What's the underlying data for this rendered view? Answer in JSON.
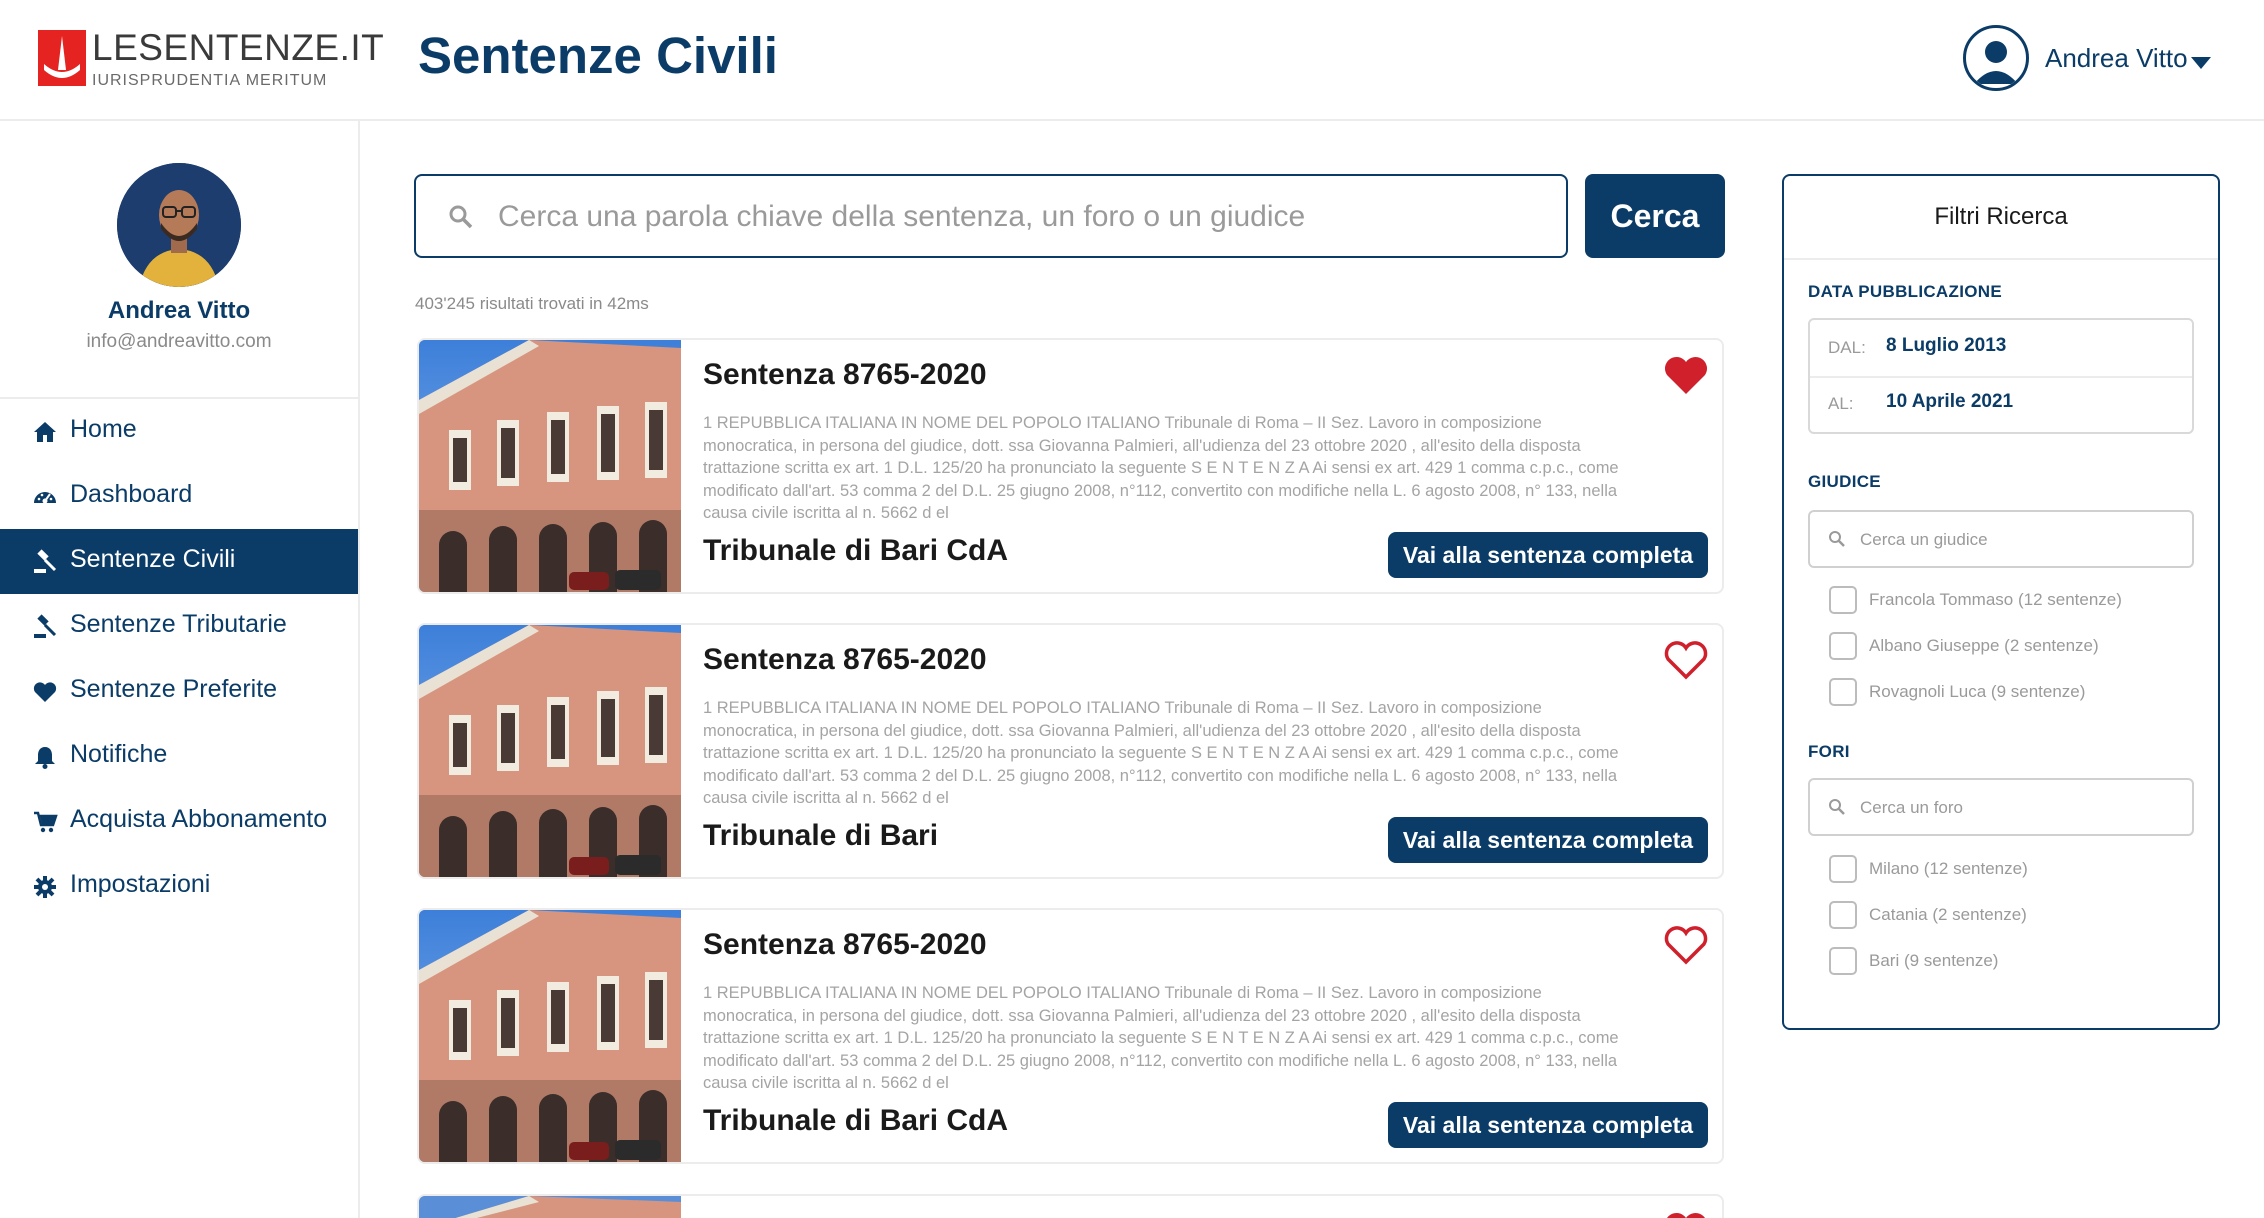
{
  "brand": {
    "name": "LESENTENZE.IT",
    "tagline": "IURISPRUDENTIA MERITUM",
    "color": "#e52421"
  },
  "colors": {
    "primary": "#0b3c67",
    "favorite": "#d0202c"
  },
  "header": {
    "title": "Sentenze Civili",
    "user_name": "Andrea Vitto"
  },
  "profile": {
    "name": "Andrea Vitto",
    "email": "info@andreavitto.com"
  },
  "nav": {
    "items": [
      {
        "label": "Home",
        "icon": "home-icon",
        "active": false
      },
      {
        "label": "Dashboard",
        "icon": "dashboard-icon",
        "active": false
      },
      {
        "label": "Sentenze Civili",
        "icon": "gavel-icon",
        "active": true
      },
      {
        "label": "Sentenze Tributarie",
        "icon": "gavel-icon",
        "active": false
      },
      {
        "label": "Sentenze Preferite",
        "icon": "heart-icon",
        "active": false
      },
      {
        "label": "Notifiche",
        "icon": "bell-icon",
        "active": false
      },
      {
        "label": "Acquista Abbonamento",
        "icon": "cart-icon",
        "active": false
      },
      {
        "label": "Impostazioni",
        "icon": "gear-icon",
        "active": false
      }
    ]
  },
  "search": {
    "placeholder": "Cerca una parola chiave della sentenza, un foro o un giudice",
    "value": "",
    "button_label": "Cerca",
    "results_count": "403'245 risultati trovati in 42ms"
  },
  "results": [
    {
      "title": "Sentenza 8765-2020",
      "text": "1 REPUBBLICA ITALIANA IN NOME DEL POPOLO ITALIANO Tribunale di Roma – II Sez. Lavoro in composizione monocratica, in persona del giudice, dott. ssa Giovanna Palmieri, all'udienza del 23 ottobre 2020 , all'esito della disposta trattazione scritta ex art. 1 D.L. 125/20 ha pronunciato la seguente S E N T E N Z A Ai sensi ex art. 429 1 comma c.p.c., come modificato dall'art. 53 comma 2 del D.L. 25 giugno 2008, n°112, convertito con modifiche nella L. 6 agosto 2008, n° 133, nella causa civile iscritta al n. 5662 d el",
      "court": "Tribunale di Bari CdA",
      "button_label": "Vai alla sentenza completa",
      "favorite": true
    },
    {
      "title": "Sentenza 8765-2020",
      "text": "1 REPUBBLICA ITALIANA IN NOME DEL POPOLO ITALIANO Tribunale di Roma – II Sez. Lavoro in composizione monocratica, in persona del giudice, dott. ssa Giovanna Palmieri, all'udienza del 23 ottobre 2020 , all'esito della disposta trattazione scritta ex art. 1 D.L. 125/20 ha pronunciato la seguente S E N T E N Z A Ai sensi ex art. 429 1 comma c.p.c., come modificato dall'art. 53 comma 2 del D.L. 25 giugno 2008, n°112, convertito con modifiche nella L. 6 agosto 2008, n° 133, nella causa civile iscritta al n. 5662 d el",
      "court": "Tribunale di Bari",
      "button_label": "Vai alla sentenza completa",
      "favorite": false
    },
    {
      "title": "Sentenza 8765-2020",
      "text": "1 REPUBBLICA ITALIANA IN NOME DEL POPOLO ITALIANO Tribunale di Roma – II Sez. Lavoro in composizione monocratica, in persona del giudice, dott. ssa Giovanna Palmieri, all'udienza del 23 ottobre 2020 , all'esito della disposta trattazione scritta ex art. 1 D.L. 125/20 ha pronunciato la seguente S E N T E N Z A Ai sensi ex art. 429 1 comma c.p.c., come modificato dall'art. 53 comma 2 del D.L. 25 giugno 2008, n°112, convertito con modifiche nella L. 6 agosto 2008, n° 133, nella causa civile iscritta al n. 5662 d el",
      "court": "Tribunale di Bari CdA",
      "button_label": "Vai alla sentenza completa",
      "favorite": false
    },
    {
      "title": "",
      "text": "",
      "court": "",
      "button_label": "",
      "favorite": true
    }
  ],
  "filters": {
    "title": "Filtri Ricerca",
    "date_section": "DATA PUBBLICAZIONE",
    "from_label": "DAL:",
    "from_value": "8 Luglio 2013",
    "to_label": "AL:",
    "to_value": "10 Aprile 2021",
    "judge_section": "GIUDICE",
    "judge_placeholder": "Cerca un giudice",
    "judges": [
      "Francola Tommaso (12 sentenze)",
      "Albano Giuseppe (2 sentenze)",
      "Rovagnoli Luca (9 sentenze)"
    ],
    "court_section": "FORI",
    "court_placeholder": "Cerca un foro",
    "courts": [
      "Milano (12 sentenze)",
      "Catania (2 sentenze)",
      "Bari (9 sentenze)"
    ]
  }
}
